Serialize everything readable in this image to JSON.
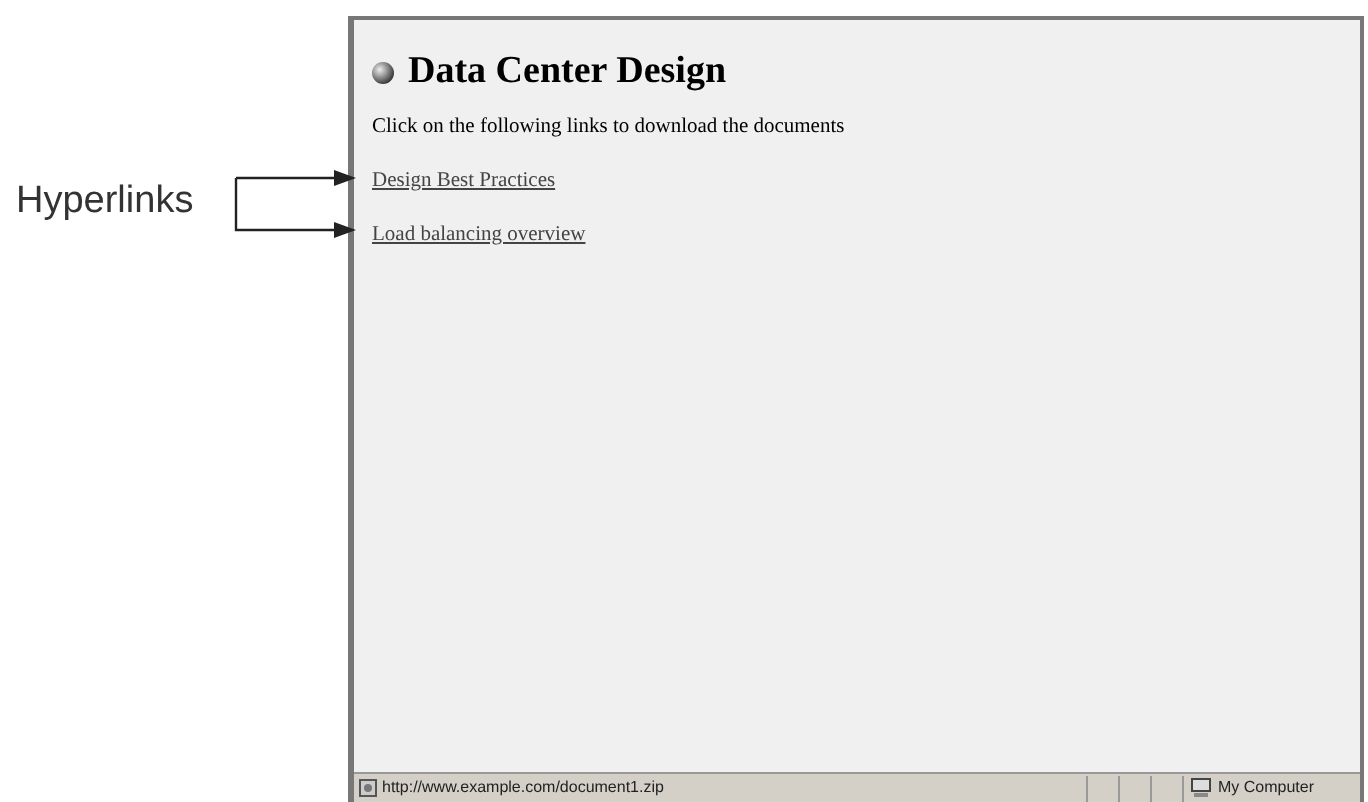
{
  "annotation": {
    "label": "Hyperlinks"
  },
  "page": {
    "title": "Data Center Design",
    "intro": "Click on the following links to download the documents",
    "links": [
      "Design Best Practices",
      "Load balancing overview"
    ]
  },
  "status_bar": {
    "url": "http://www.example.com/document1.zip",
    "zone": "My Computer"
  }
}
